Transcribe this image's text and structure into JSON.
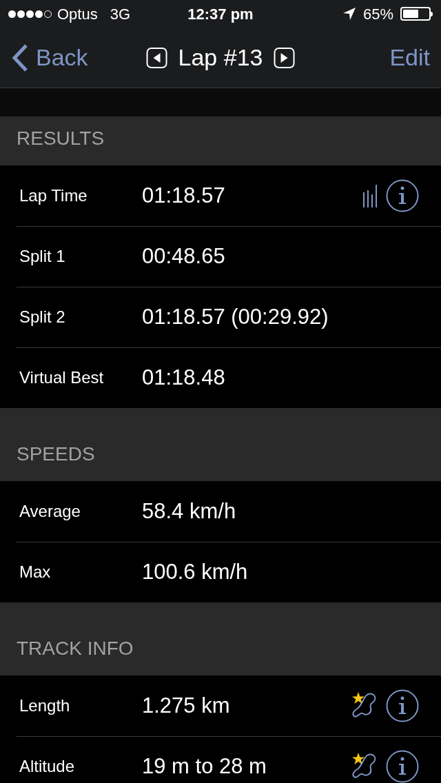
{
  "status_bar": {
    "carrier": "Optus",
    "network": "3G",
    "time": "12:37 pm",
    "battery": "65%"
  },
  "nav": {
    "back": "Back",
    "title": "Lap #13",
    "edit": "Edit"
  },
  "sections": [
    {
      "title": "RESULTS",
      "rows": [
        {
          "label": "Lap Time",
          "value": "01:18.57",
          "kind": "chart"
        },
        {
          "label": "Split 1",
          "value": "00:48.65",
          "kind": "plain"
        },
        {
          "label": "Split 2",
          "value": "01:18.57 (00:29.92)",
          "kind": "plain"
        },
        {
          "label": "Virtual Best",
          "value": "01:18.48",
          "kind": "plain"
        }
      ]
    },
    {
      "title": "SPEEDS",
      "rows": [
        {
          "label": "Average",
          "value": "58.4 km/h",
          "kind": "plain"
        },
        {
          "label": "Max",
          "value": "100.6 km/h",
          "kind": "plain"
        }
      ]
    },
    {
      "title": "TRACK INFO",
      "rows": [
        {
          "label": "Length",
          "value": "1.275 km",
          "kind": "track"
        },
        {
          "label": "Altitude",
          "value": "19 m to 28 m",
          "kind": "track"
        }
      ]
    }
  ]
}
